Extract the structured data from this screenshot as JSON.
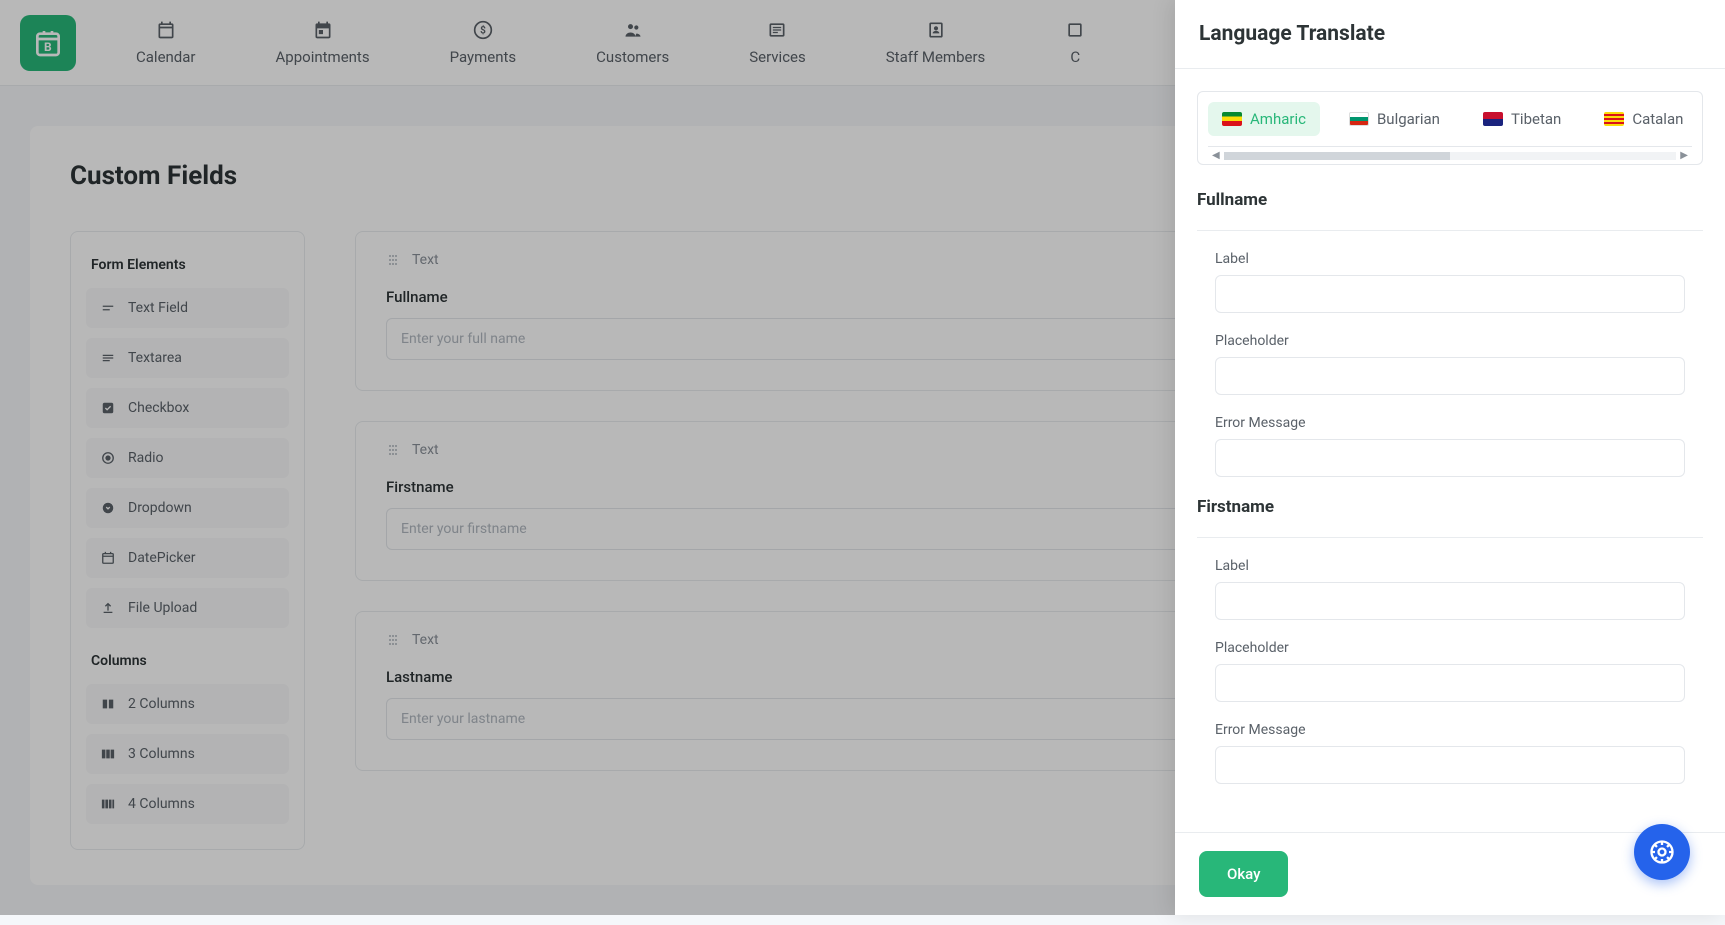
{
  "nav": {
    "items": [
      {
        "label": "Calendar"
      },
      {
        "label": "Appointments"
      },
      {
        "label": "Payments"
      },
      {
        "label": "Customers"
      },
      {
        "label": "Services"
      },
      {
        "label": "Staff Members"
      }
    ],
    "truncated_label": "C"
  },
  "page": {
    "title": "Custom Fields"
  },
  "elements_panel": {
    "form_elements_title": "Form Elements",
    "form_elements": [
      {
        "label": "Text Field"
      },
      {
        "label": "Textarea"
      },
      {
        "label": "Checkbox"
      },
      {
        "label": "Radio"
      },
      {
        "label": "Dropdown"
      },
      {
        "label": "DatePicker"
      },
      {
        "label": "File Upload"
      }
    ],
    "columns_title": "Columns",
    "columns": [
      {
        "label": "2 Columns"
      },
      {
        "label": "3 Columns"
      },
      {
        "label": "4 Columns"
      }
    ]
  },
  "canvas": {
    "fields": [
      {
        "type": "Text",
        "label": "Fullname",
        "placeholder": "Enter your full name"
      },
      {
        "type": "Text",
        "label": "Firstname",
        "placeholder": "Enter your firstname"
      },
      {
        "type": "Text",
        "label": "Lastname",
        "placeholder": "Enter your lastname"
      }
    ]
  },
  "drawer": {
    "title": "Language Translate",
    "languages": [
      {
        "label": "Amharic",
        "active": true
      },
      {
        "label": "Bulgarian",
        "active": false
      },
      {
        "label": "Tibetan",
        "active": false
      },
      {
        "label": "Catalan",
        "active": false
      }
    ],
    "sections": [
      {
        "heading": "Fullname",
        "fields": [
          {
            "label": "Label"
          },
          {
            "label": "Placeholder"
          },
          {
            "label": "Error Message"
          }
        ]
      },
      {
        "heading": "Firstname",
        "fields": [
          {
            "label": "Label"
          },
          {
            "label": "Placeholder"
          },
          {
            "label": "Error Message"
          }
        ]
      }
    ],
    "okay_label": "Okay"
  }
}
